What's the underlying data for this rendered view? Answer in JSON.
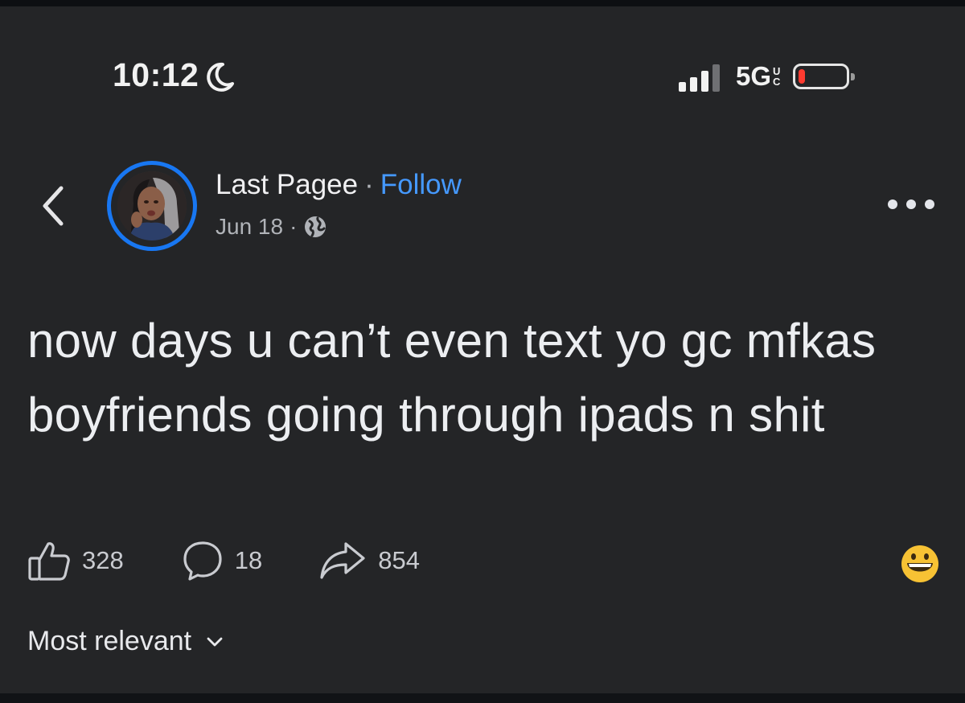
{
  "status_bar": {
    "time": "10:12",
    "network": "5G",
    "network_sup": [
      "U",
      "C"
    ],
    "battery_level": 0.15,
    "battery_color": "#ff3b30"
  },
  "post": {
    "author": "Last Pagee",
    "separator": "·",
    "follow_label": "Follow",
    "date": "Jun 18",
    "audience_icon": "globe-icon",
    "text": "now days u can’t even text yo gc mfkas boyfriends going through ipads n shit",
    "likes": "328",
    "comments": "18",
    "shares": "854"
  },
  "comments_sort": {
    "label": "Most relevant"
  },
  "colors": {
    "background": "#242527",
    "accent": "#4599ff",
    "ring": "#1877f2",
    "muted": "#b0b3b8"
  }
}
